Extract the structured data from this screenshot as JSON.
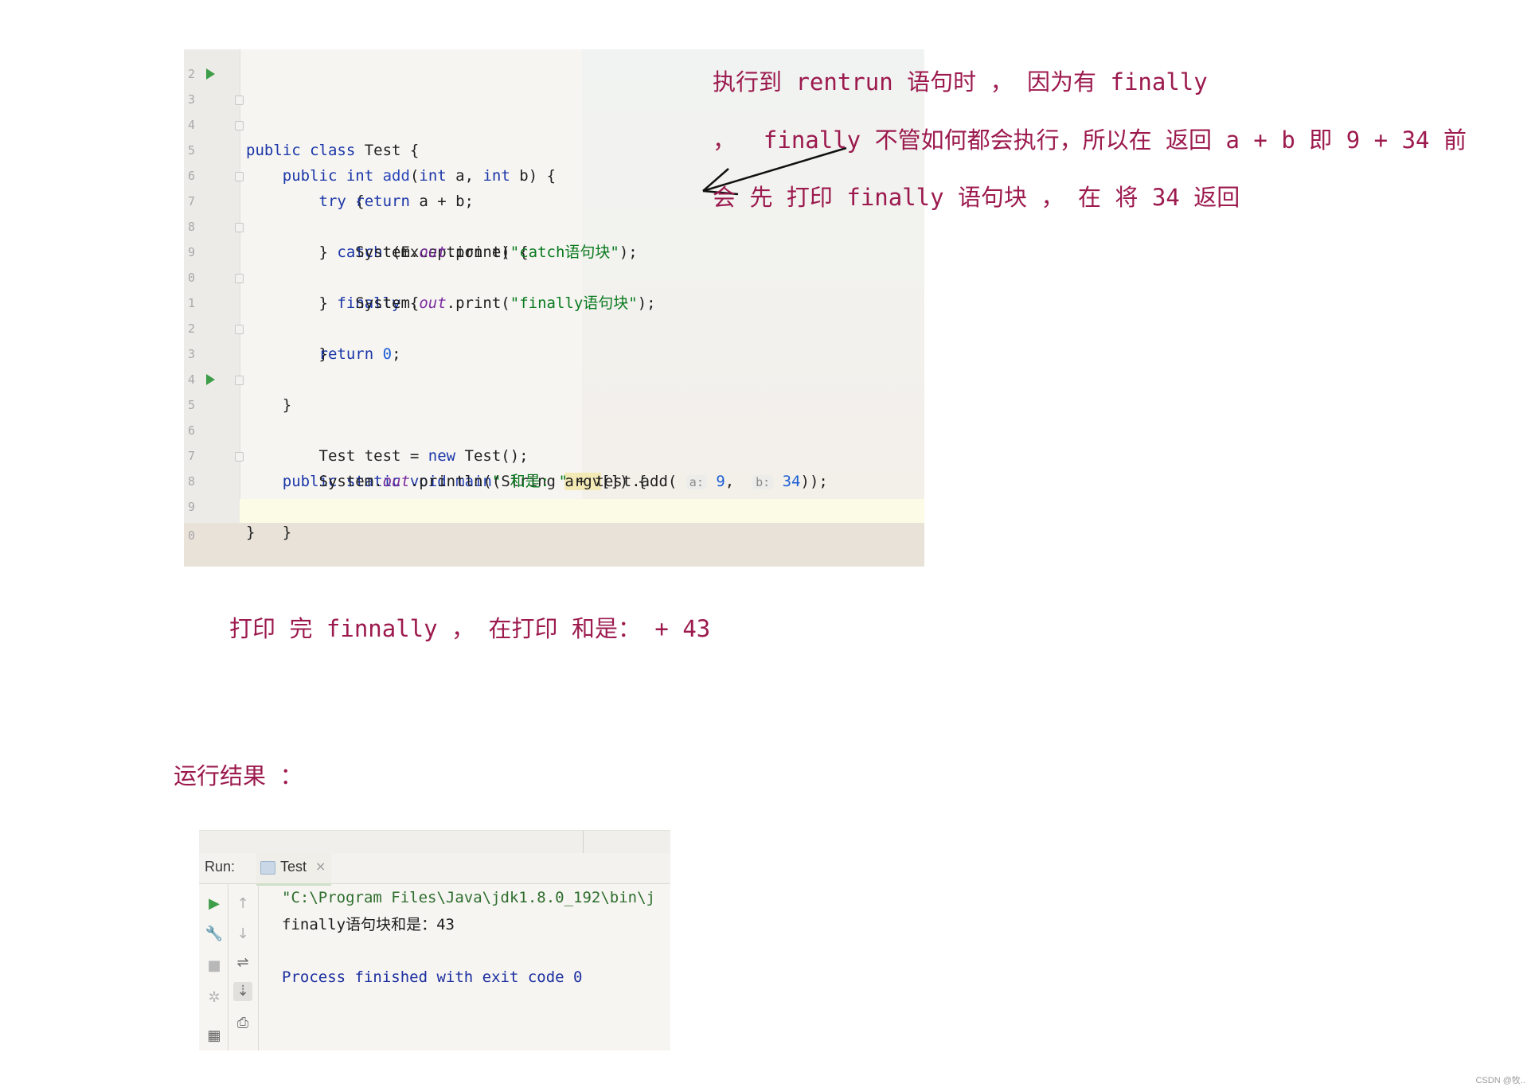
{
  "editor": {
    "lines": [
      {
        "n": "2",
        "text": ""
      },
      {
        "n": "3",
        "text": "public class Test {"
      },
      {
        "n": "4",
        "text": "    public int add(int a, int b) {"
      },
      {
        "n": "5",
        "text": "        try {"
      },
      {
        "n": "6",
        "text": "            return a + b;"
      },
      {
        "n": "7",
        "text": "        } catch (Exception e) {"
      },
      {
        "n": "8",
        "text": "            System.out.print(\"catch语句块\");"
      },
      {
        "n": "9",
        "text": "        } finally {"
      },
      {
        "n": "0",
        "text": "            System.out.print(\"finally语句块\");"
      },
      {
        "n": "1",
        "text": "        }"
      },
      {
        "n": "2",
        "text": "        return 0;"
      },
      {
        "n": "3",
        "text": "    }"
      },
      {
        "n": "4",
        "text": ""
      },
      {
        "n": "5",
        "text": "    public static void main(String argv[]) {"
      },
      {
        "n": "6",
        "text": "        Test test = new Test();"
      },
      {
        "n": "7",
        "text": "        System.out.println(\" 和是: \" + test.add( a: 9,  b: 34));"
      },
      {
        "n": "8",
        "text": "    }"
      },
      {
        "n": "9",
        "text": "}"
      },
      {
        "n": "0",
        "text": ""
      }
    ]
  },
  "notes": {
    "line1": "执行到 rentrun 语句时 ， 因为有 finally",
    "line2": "，  finally 不管如何都会执行，所以在 返回 a + b 即 9 + 34 前",
    "line3": "会 先 打印 finally 语句块 ， 在 将 34 返回",
    "line4": "打印 完 finnally ， 在打印 和是： + 43",
    "run_result": "运行结果 ："
  },
  "console": {
    "run_label": "Run:",
    "tab_label": "Test",
    "tab_close": "×",
    "cmd_line": "\"C:\\Program Files\\Java\\jdk1.8.0_192\\bin\\j",
    "output_line": "finally语句块和是：43",
    "process_line": "Process finished with exit code 0"
  },
  "watermark": "CSDN @牧..",
  "colors": {
    "annotation": "#9c1a4e",
    "keyword": "#1b36a8",
    "string": "#0a7a1f",
    "run_green": "#3e9d48"
  }
}
